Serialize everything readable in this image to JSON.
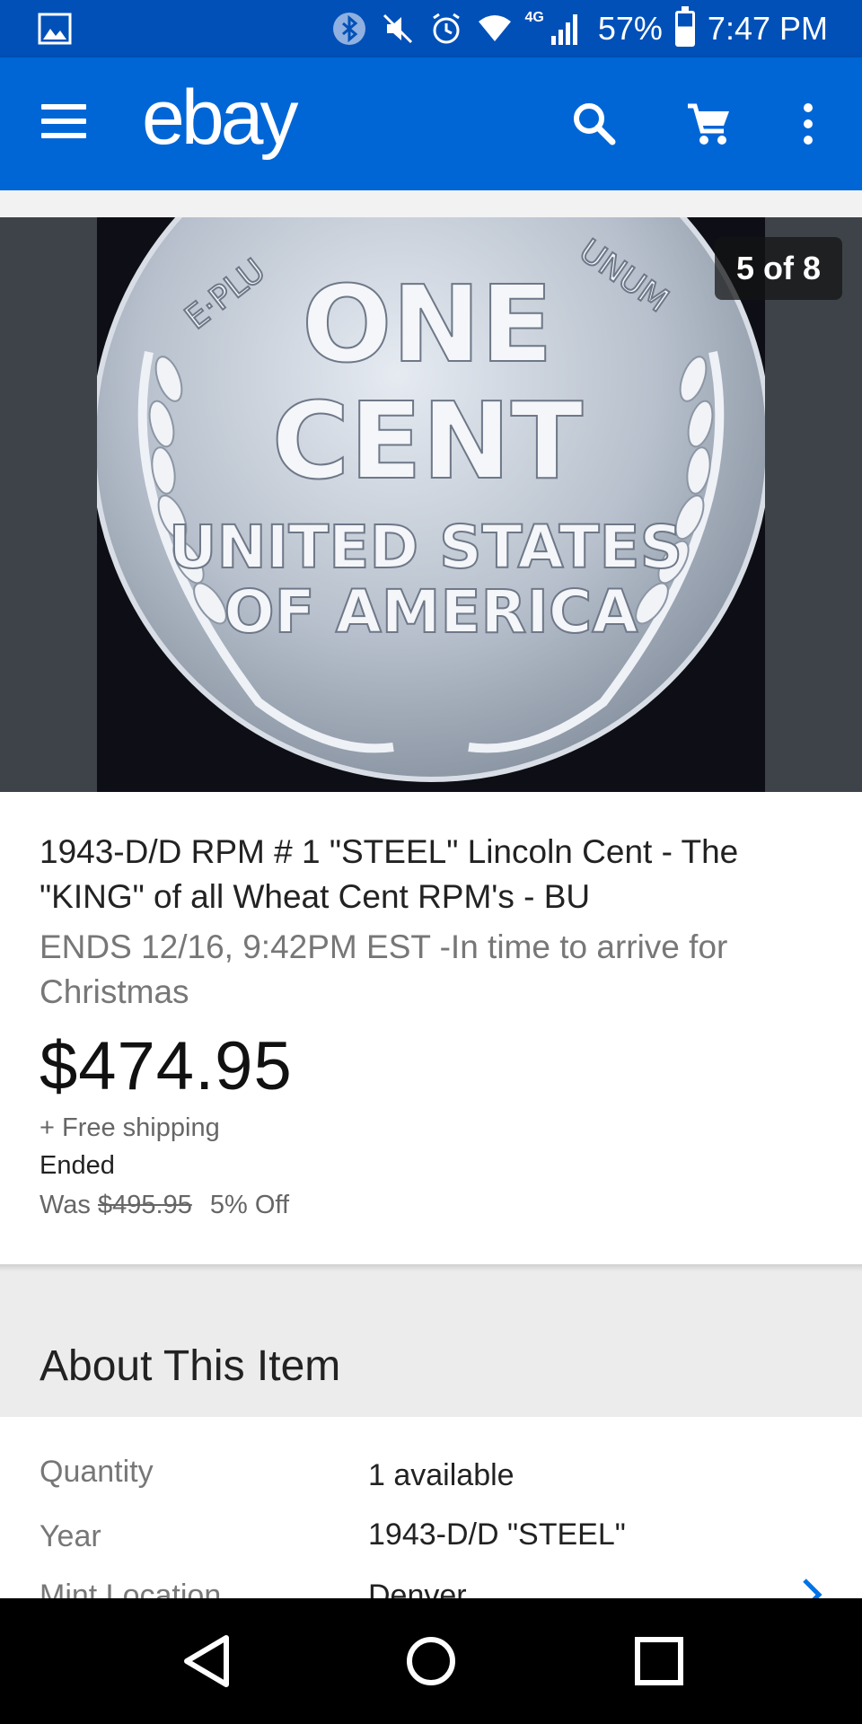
{
  "status_bar": {
    "network": "4G",
    "battery": "57%",
    "time": "7:47 PM",
    "icons": [
      "gallery-icon",
      "bluetooth-icon",
      "mute-icon",
      "alarm-icon",
      "wifi-icon",
      "signal-icon",
      "battery-icon"
    ]
  },
  "app_bar": {
    "logo": "ebay",
    "icons": [
      "menu-icon",
      "search-icon",
      "cart-icon",
      "more-vert-icon"
    ]
  },
  "carousel": {
    "counter": "5 of 8",
    "image_alt_text": [
      "E·PLU",
      "UNUM",
      "ONE",
      "CENT",
      "UNITED STATES",
      "OF AMERICA"
    ]
  },
  "item": {
    "title": "1943-D/D RPM # 1 \"STEEL\" Lincoln Cent - The \"KING\" of all Wheat Cent RPM's - BU",
    "ends": "ENDS 12/16, 9:42PM EST -In time to arrive for Christmas",
    "price": "$474.95",
    "shipping": "+ Free shipping",
    "status": "Ended",
    "was_prefix": "Was",
    "was_price": "$495.95",
    "discount": "5% Off"
  },
  "about": {
    "title": "About This Item",
    "specs": [
      {
        "label": "Quantity",
        "value": "1 available"
      },
      {
        "label": "Year",
        "value": "1943-D/D \"STEEL\""
      },
      {
        "label": "Mint Location",
        "value": "Denver"
      }
    ]
  },
  "colors": {
    "status_bar": "#0050b8",
    "app_bar": "#0066d6",
    "link_chevron": "#0073e6"
  },
  "nav_bar": {
    "icons": [
      "back-icon",
      "home-icon",
      "recent-apps-icon"
    ]
  }
}
